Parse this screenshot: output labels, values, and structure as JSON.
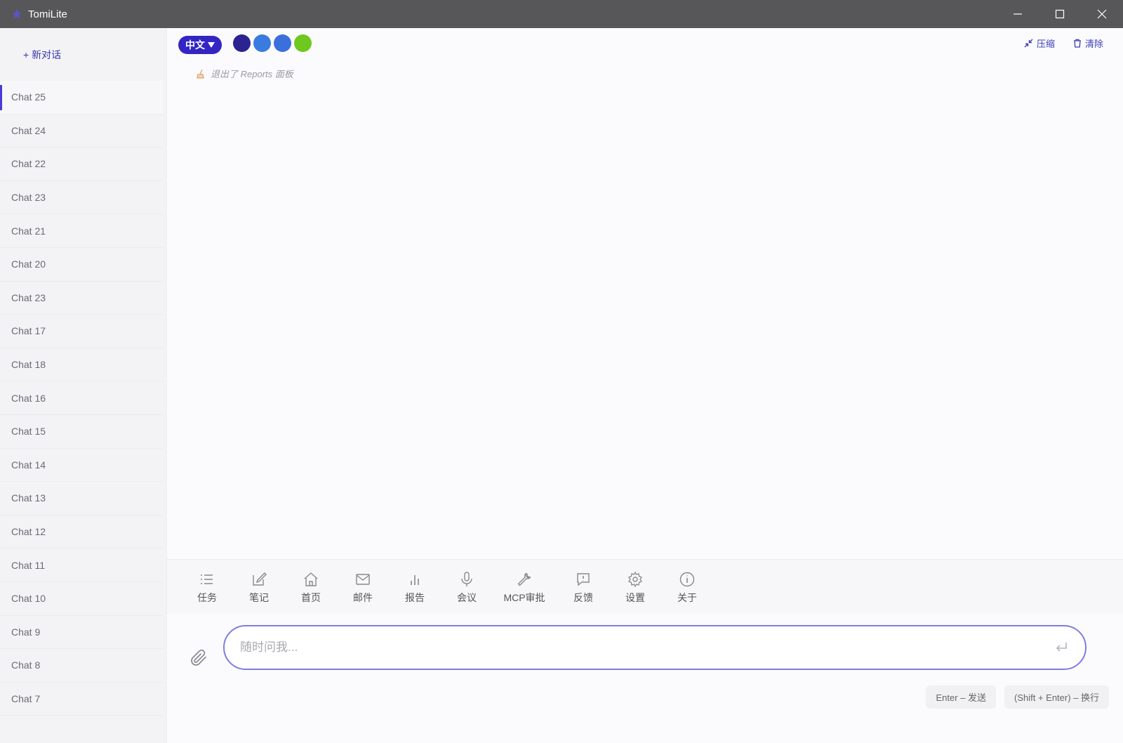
{
  "window": {
    "title": "TomiLite"
  },
  "sidebar": {
    "new_chat_label": "+ 新对话",
    "chats": [
      {
        "label": "Chat 25",
        "active": true
      },
      {
        "label": "Chat 24"
      },
      {
        "label": "Chat 22"
      },
      {
        "label": "Chat 23"
      },
      {
        "label": "Chat 21"
      },
      {
        "label": "Chat 20"
      },
      {
        "label": "Chat 23"
      },
      {
        "label": "Chat 17"
      },
      {
        "label": "Chat 18"
      },
      {
        "label": "Chat 16"
      },
      {
        "label": "Chat 15"
      },
      {
        "label": "Chat 14"
      },
      {
        "label": "Chat 13"
      },
      {
        "label": "Chat 12"
      },
      {
        "label": "Chat 11"
      },
      {
        "label": "Chat 10"
      },
      {
        "label": "Chat 9"
      },
      {
        "label": "Chat 8"
      },
      {
        "label": "Chat 7"
      }
    ]
  },
  "topbar": {
    "language_label": "中文",
    "swatches": [
      "#2a2390",
      "#3a7be0",
      "#3b6fdc",
      "#6ec81e"
    ],
    "compress_label": "压缩",
    "clear_label": "清除",
    "accent": "#3325c4"
  },
  "messages": {
    "system_note": "退出了 Reports 面板"
  },
  "toolbar": {
    "items": [
      {
        "label": "任务",
        "icon": "list-icon"
      },
      {
        "label": "笔记",
        "icon": "edit-icon"
      },
      {
        "label": "首页",
        "icon": "home-icon"
      },
      {
        "label": "邮件",
        "icon": "mail-icon"
      },
      {
        "label": "报告",
        "icon": "bar-chart-icon"
      },
      {
        "label": "会议",
        "icon": "microphone-icon"
      },
      {
        "label": "MCP审批",
        "icon": "wrench-icon"
      },
      {
        "label": "反馈",
        "icon": "feedback-icon"
      },
      {
        "label": "设置",
        "icon": "gear-icon"
      },
      {
        "label": "关于",
        "icon": "info-icon"
      }
    ]
  },
  "input": {
    "placeholder": "随时问我...",
    "value": "",
    "hint_send": "Enter – 发送",
    "hint_newline": "(Shift + Enter) – 换行"
  }
}
